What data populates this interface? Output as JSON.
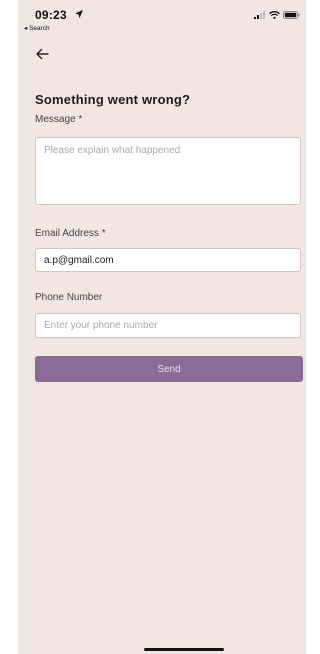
{
  "status_bar": {
    "time": "09:23",
    "back_app": "◂ Search"
  },
  "form": {
    "title": "Something went wrong?",
    "message_label": "Message *",
    "message_placeholder": "Please explain what happened",
    "email_label": "Email Address *",
    "email_value": "a.p@gmail.com",
    "phone_label": "Phone Number",
    "phone_placeholder": "Enter your phone number",
    "send_label": "Send"
  },
  "colors": {
    "background": "#f1e6e2",
    "button": "#8a6b94",
    "button_text": "#e9dcef"
  }
}
